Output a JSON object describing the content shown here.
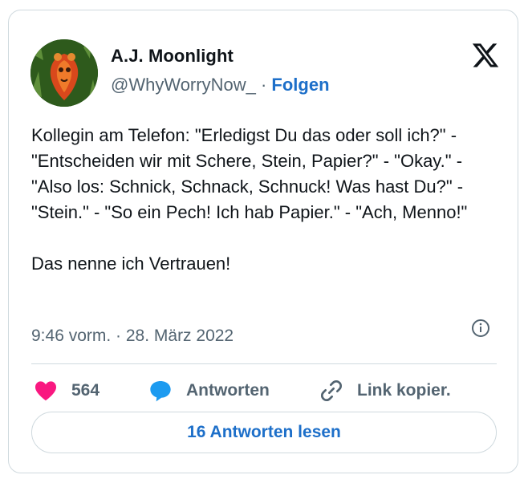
{
  "author": {
    "name": "A.J. Moonlight",
    "handle": "@WhyWorryNow_",
    "separator": "·",
    "follow_label": "Folgen"
  },
  "tweet": {
    "text": "Kollegin am Telefon: \"Erledigst Du das oder soll ich?\" - \"Entscheiden wir mit Schere, Stein, Papier?\" - \"Okay.\" - \"Also los: Schnick, Schnack, Schnuck! Was hast Du?\" - \"Stein.\" - \"So ein Pech! Ich hab Papier.\" - \"Ach, Menno!\"\n\nDas nenne ich Vertrauen!",
    "timestamp": "9:46 vorm. · 28. März 2022"
  },
  "actions": {
    "like_count": "564",
    "reply_label": "Antworten",
    "copy_link_label": "Link kopier."
  },
  "footer": {
    "read_replies_label": "16 Antworten lesen"
  },
  "icons": {
    "logo": "x-logo-icon",
    "info": "info-icon",
    "like": "heart-icon",
    "reply": "speech-bubble-icon",
    "link": "link-icon"
  },
  "colors": {
    "accent": "#1d6fc9",
    "like": "#f91880",
    "reply": "#1d9bf0",
    "muted": "#536471",
    "text": "#0f1419",
    "border": "#cfd9de"
  }
}
